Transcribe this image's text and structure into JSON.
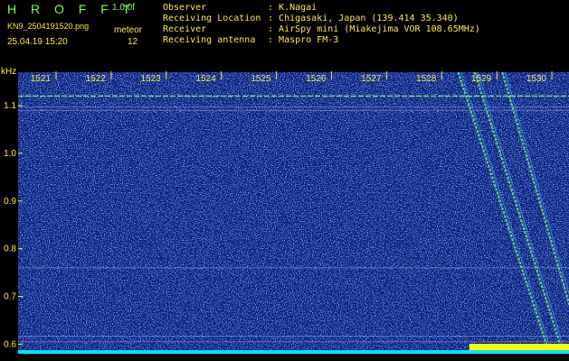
{
  "header": {
    "app_title": "H R O F F T",
    "version": "1.0.0f",
    "filename": "KN9_2504191520.png",
    "mode": "meteor",
    "datetime": "25.04.19 15:20",
    "count": "12",
    "info": [
      {
        "label": "Observer",
        "value": "K.Nagai"
      },
      {
        "label": "Receiving Location",
        "value": "Chigasaki, Japan (139.414 35.340)"
      },
      {
        "label": "Receiver",
        "value": "AirSpy mini (Miakejima VOR 108.65MHz)"
      },
      {
        "label": "Receiving antenna",
        "value": "Maspro FM-3"
      }
    ]
  },
  "chart_data": {
    "type": "heatmap",
    "ylabel": "kHz",
    "x_ticks": [
      "1521",
      "1522",
      "1523",
      "1524",
      "1525",
      "1526",
      "1527",
      "1528",
      "1529",
      "1530"
    ],
    "y_ticks": [
      "1.1",
      "1.0",
      "0.9",
      "0.8",
      "0.7",
      "0.6"
    ],
    "y_range_khz": [
      0.58,
      1.17
    ],
    "background_color": "#0a1e78",
    "noise_color": "#2f6bff",
    "signal_color": "#7dff7a",
    "axis_label_color": "#ffe84a",
    "amplitude_color": "#00e5ff",
    "burst_color": "#ffff00",
    "horizontal_lines_khz": [
      1.12,
      1.097,
      1.09,
      0.76,
      0.617,
      0.605
    ],
    "meteor_trails": [
      {
        "x_start": 1528.3,
        "y_start_khz": 1.17,
        "x_end": 1529.9,
        "y_end_khz": 0.6
      },
      {
        "x_start": 1528.6,
        "y_start_khz": 1.17,
        "x_end": 1530.15,
        "y_end_khz": 0.6
      },
      {
        "x_start": 1529.1,
        "y_start_khz": 1.17,
        "x_end": 1530.4,
        "y_end_khz": 0.65
      }
    ],
    "burst_range_x": [
      1528.5,
      1530.5
    ]
  }
}
